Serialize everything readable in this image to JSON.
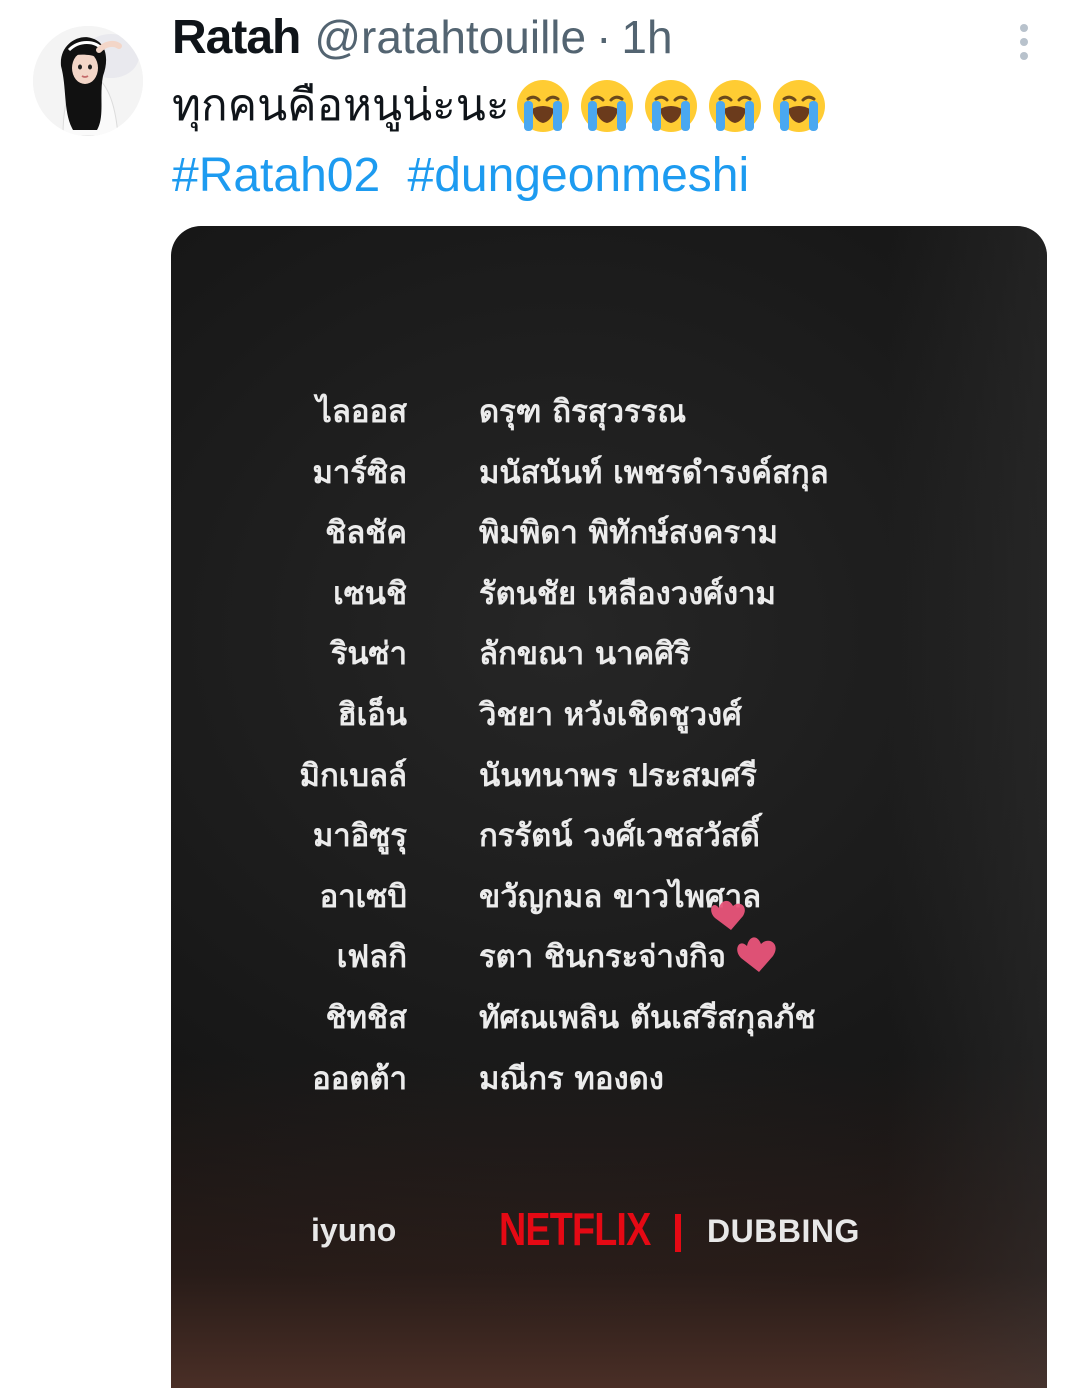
{
  "tweet": {
    "author": {
      "display_name": "Ratah",
      "handle": "@ratahtouille",
      "separator": "·",
      "time": "1h",
      "avatar_icon": "profile-photo"
    },
    "text": "ทุกคนคือหนูน่ะนะ",
    "emojis": [
      "loudly-crying-face",
      "loudly-crying-face",
      "loudly-crying-face",
      "loudly-crying-face",
      "loudly-crying-face"
    ],
    "hashtags": [
      "#Ratah02",
      "#dungeonmeshi"
    ],
    "more_icon": "more-vertical-icon",
    "colors": {
      "link": "#1d9bf0",
      "secondary_text": "#536471",
      "primary_text": "#0f1419"
    }
  },
  "media": {
    "credits": [
      {
        "role": "ไลออส",
        "actor": "ดรุฑ ถิรสุวรรณ"
      },
      {
        "role": "มาร์ซิล",
        "actor": "มนัสนันท์ เพชรดำรงค์สกุล"
      },
      {
        "role": "ชิลชัค",
        "actor": "พิมพิดา พิทักษ์สงคราม"
      },
      {
        "role": "เซนชิ",
        "actor": "รัตนชัย เหลืองวงศ์งาม"
      },
      {
        "role": "รินซ่า",
        "actor": "ลักขณา นาคศิริ"
      },
      {
        "role": "ฮิเอ็น",
        "actor": "วิชยา หวังเชิดชูวงศ์"
      },
      {
        "role": "มิกเบลล์",
        "actor": "นันทนาพร ประสมศรี"
      },
      {
        "role": "มาอิซูรุ",
        "actor": "กรรัตน์ วงศ์เวชสวัสดิ์"
      },
      {
        "role": "อาเซบิ",
        "actor": "ขวัญกมล ขาวไพศาล"
      },
      {
        "role": "เฟลกิ",
        "actor": "รตา ชินกระจ่างกิจ"
      },
      {
        "role": "ชิทชิส",
        "actor": "ทัศณเพลิน ตันเสรีสกุลภัช"
      },
      {
        "role": "ออตต้า",
        "actor": "มณีกร ทองดง"
      }
    ],
    "footer": {
      "left_logo": "iyuno",
      "netflix": "NETFLIX",
      "dubbing": "DUBBING"
    },
    "decoration": "pink-hearts-sticker",
    "colors": {
      "netflix_red": "#e50914",
      "heart_pink": "#e9547a"
    }
  }
}
